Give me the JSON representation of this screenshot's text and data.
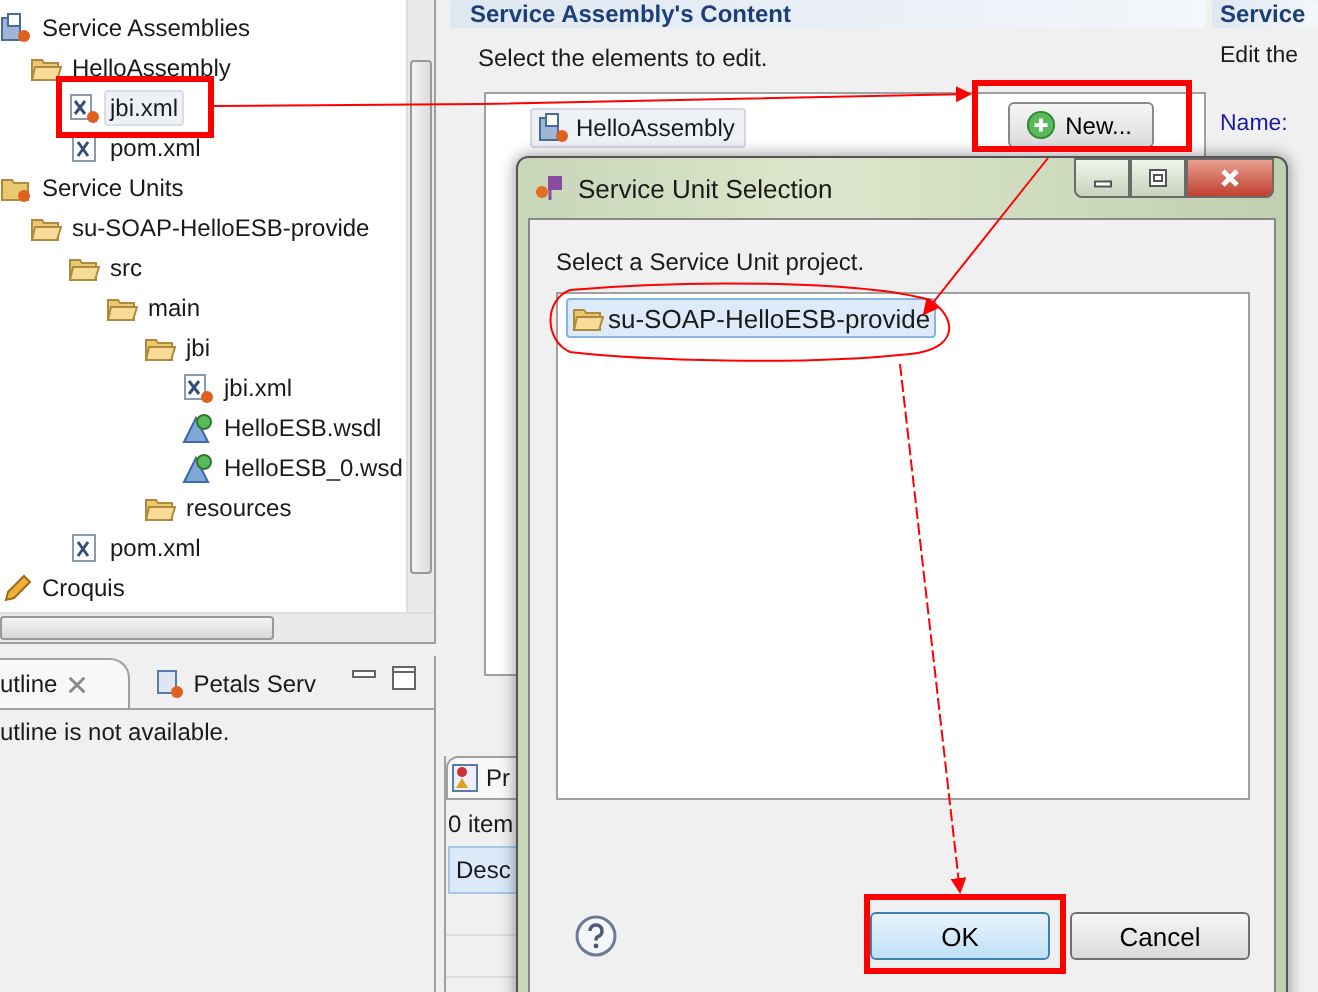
{
  "project_tree": {
    "items": [
      {
        "label": "Service Assemblies",
        "kind": "assemblies",
        "selected": false,
        "children": [
          {
            "label": "HelloAssembly",
            "kind": "folder",
            "selected": false,
            "children": [
              {
                "label": "jbi.xml",
                "kind": "jbi",
                "selected": true
              },
              {
                "label": "pom.xml",
                "kind": "xml",
                "selected": false
              }
            ]
          }
        ]
      },
      {
        "label": "Service Units",
        "kind": "units",
        "selected": false,
        "children": [
          {
            "label": "su-SOAP-HelloESB-provide",
            "kind": "folder",
            "selected": false,
            "children": [
              {
                "label": "src",
                "kind": "folder",
                "selected": false,
                "children": [
                  {
                    "label": "main",
                    "kind": "folder",
                    "selected": false,
                    "children": [
                      {
                        "label": "jbi",
                        "kind": "folder",
                        "selected": false,
                        "children": [
                          {
                            "label": "jbi.xml",
                            "kind": "jbi",
                            "selected": false
                          },
                          {
                            "label": "HelloESB.wsdl",
                            "kind": "wsdl",
                            "selected": false
                          },
                          {
                            "label": "HelloESB_0.wsd",
                            "kind": "wsdl",
                            "selected": false
                          }
                        ]
                      },
                      {
                        "label": "resources",
                        "kind": "folder",
                        "selected": false
                      }
                    ]
                  }
                ]
              },
              {
                "label": "pom.xml",
                "kind": "xml",
                "selected": false
              }
            ]
          }
        ]
      },
      {
        "label": "Croquis",
        "kind": "sketch",
        "selected": false
      }
    ]
  },
  "outline_view": {
    "tabs": [
      {
        "label": "utline",
        "selected": true,
        "closable": true
      },
      {
        "label": "Petals Serv",
        "selected": false,
        "closable": false
      }
    ],
    "message": "utline is not available."
  },
  "editor": {
    "section_title": "Service Assembly's Content",
    "description": "Select the elements to edit.",
    "elements": [
      {
        "label": "HelloAssembly"
      }
    ],
    "new_button": "New..."
  },
  "problems_view": {
    "tab": "Pr",
    "count": "0 item",
    "column": "Desc"
  },
  "details": {
    "title": "Service",
    "description": "Edit the",
    "fields": [
      {
        "label": "Name:"
      }
    ]
  },
  "dialog": {
    "title": "Service Unit Selection",
    "prompt": "Select a Service Unit project.",
    "projects": [
      {
        "label": "su-SOAP-HelloESB-provide",
        "selected": true
      }
    ],
    "buttons": [
      {
        "label": "OK",
        "default": true
      },
      {
        "label": "Cancel",
        "default": false
      }
    ]
  }
}
